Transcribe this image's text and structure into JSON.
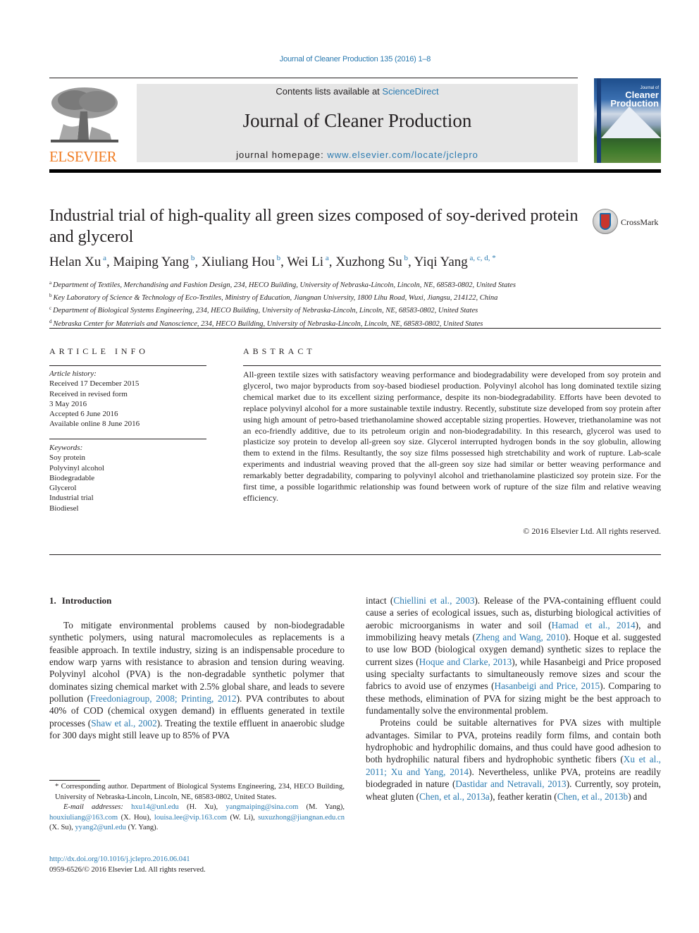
{
  "header": {
    "journal_ref": "Journal of Cleaner Production 135 (2016) 1–8",
    "contents_prefix": "Contents lists available at ",
    "contents_link": "ScienceDirect",
    "journal_title": "Journal of Cleaner Production",
    "homepage_prefix": "journal homepage: ",
    "homepage_link": "www.elsevier.com/locate/jclepro",
    "publisher_wordmark": "ELSEVIER",
    "cover_kicker": "Journal of",
    "cover_title_1": "Cleaner",
    "cover_title_2": "Production",
    "crossmark_label": "CrossMark"
  },
  "article": {
    "title": "Industrial trial of high-quality all green sizes composed of soy-derived protein and glycerol",
    "authors": [
      {
        "name": "Helan Xu",
        "sup": "a"
      },
      {
        "name": "Maiping Yang",
        "sup": "b"
      },
      {
        "name": "Xiuliang Hou",
        "sup": "b"
      },
      {
        "name": "Wei Li",
        "sup": "a"
      },
      {
        "name": "Xuzhong Su",
        "sup": "b"
      },
      {
        "name": "Yiqi Yang",
        "sup": "a, c, d, *"
      }
    ],
    "affiliations": [
      {
        "key": "a",
        "text": "Department of Textiles, Merchandising and Fashion Design, 234, HECO Building, University of Nebraska-Lincoln, Lincoln, NE, 68583-0802, United States"
      },
      {
        "key": "b",
        "text": "Key Laboratory of Science & Technology of Eco-Textiles, Ministry of Education, Jiangnan University, 1800 Lihu Road, Wuxi, Jiangsu, 214122, China"
      },
      {
        "key": "c",
        "text": "Department of Biological Systems Engineering, 234, HECO Building, University of Nebraska-Lincoln, Lincoln, NE, 68583-0802, United States"
      },
      {
        "key": "d",
        "text": "Nebraska Center for Materials and Nanoscience, 234, HECO Building, University of Nebraska-Lincoln, Lincoln, NE, 68583-0802, United States"
      }
    ]
  },
  "article_info": {
    "heading": "ARTICLE INFO",
    "history_label": "Article history:",
    "history": [
      "Received 17 December 2015",
      "Received in revised form",
      "3 May 2016",
      "Accepted 6 June 2016",
      "Available online 8 June 2016"
    ],
    "keywords_label": "Keywords:",
    "keywords": [
      "Soy protein",
      "Polyvinyl alcohol",
      "Biodegradable",
      "Glycerol",
      "Industrial trial",
      "Biodiesel"
    ]
  },
  "abstract": {
    "heading": "ABSTRACT",
    "text": "All-green textile sizes with satisfactory weaving performance and biodegradability were developed from soy protein and glycerol, two major byproducts from soy-based biodiesel production. Polyvinyl alcohol has long dominated textile sizing chemical market due to its excellent sizing performance, despite its non-biodegradability. Efforts have been devoted to replace polyvinyl alcohol for a more sustainable textile industry. Recently, substitute size developed from soy protein after using high amount of petro-based triethanolamine showed acceptable sizing properties. However, triethanolamine was not an eco-friendly additive, due to its petroleum origin and non-biodegradability. In this research, glycerol was used to plasticize soy protein to develop all-green soy size. Glycerol interrupted hydrogen bonds in the soy globulin, allowing them to extend in the films. Resultantly, the soy size films possessed high stretchability and work of rupture. Lab-scale experiments and industrial weaving proved that the all-green soy size had similar or better weaving performance and remarkably better degradability, comparing to polyvinyl alcohol and triethanolamine plasticized soy protein size. For the first time, a possible logarithmic relationship was found between work of rupture of the size film and relative weaving efficiency.",
    "copyright": "© 2016 Elsevier Ltd. All rights reserved."
  },
  "introduction": {
    "number": "1.",
    "heading": "Introduction",
    "left_column": [
      {
        "t": "To mitigate environmental problems caused by non-biodegradable synthetic polymers, using natural macromolecules as replacements is a feasible approach. In textile industry, sizing is an indispensable procedure to endow warp yarns with resistance to abrasion and tension during weaving. Polyvinyl alcohol (PVA) is the non-degradable synthetic polymer that dominates sizing chemical market with 2.5% global share, and leads to severe pollution ("
      },
      {
        "link": "Freedoniagroup, 2008; Printing, 2012"
      },
      {
        "t": "). PVA contributes to about 40% of COD (chemical oxygen demand) in effluents generated in textile processes ("
      },
      {
        "link": "Shaw et al., 2002"
      },
      {
        "t": "). Treating the textile effluent in anaerobic sludge for 300 days might still leave up to 85% of PVA"
      }
    ],
    "right_column_p1": [
      {
        "t": "intact ("
      },
      {
        "link": "Chiellini et al., 2003"
      },
      {
        "t": "). Release of the PVA-containing effluent could cause a series of ecological issues, such as, disturbing biological activities of aerobic microorganisms in water and soil ("
      },
      {
        "link": "Hamad et al., 2014"
      },
      {
        "t": "), and immobilizing heavy metals ("
      },
      {
        "link": "Zheng and Wang, 2010"
      },
      {
        "t": "). Hoque et al. suggested to use low BOD (biological oxygen demand) synthetic sizes to replace the current sizes ("
      },
      {
        "link": "Hoque and Clarke, 2013"
      },
      {
        "t": "), while Hasanbeigi and Price proposed using specialty surfactants to simultaneously remove sizes and scour the fabrics to avoid use of enzymes ("
      },
      {
        "link": "Hasanbeigi and Price, 2015"
      },
      {
        "t": "). Comparing to these methods, elimination of PVA for sizing might be the best approach to fundamentally solve the environmental problem."
      }
    ],
    "right_column_p2": [
      {
        "t": "Proteins could be suitable alternatives for PVA sizes with multiple advantages. Similar to PVA, proteins readily form films, and contain both hydrophobic and hydrophilic domains, and thus could have good adhesion to both hydrophilic natural fibers and hydrophobic synthetic fibers ("
      },
      {
        "link": "Xu et al., 2011; Xu and Yang, 2014"
      },
      {
        "t": "). Nevertheless, unlike PVA, proteins are readily biodegraded in nature ("
      },
      {
        "link": "Dastidar and Netravali, 2013"
      },
      {
        "t": "). Currently, soy protein, wheat gluten ("
      },
      {
        "link": "Chen, et al., 2013a"
      },
      {
        "t": "), feather keratin ("
      },
      {
        "link": "Chen, et al., 2013b"
      },
      {
        "t": ") and"
      }
    ]
  },
  "footnotes": {
    "corresponding": "* Corresponding author. Department of Biological Systems Engineering, 234, HECO Building, University of Nebraska-Lincoln, Lincoln, NE, 68583-0802, United States.",
    "email_label": "E-mail addresses:",
    "emails": [
      {
        "email": "hxu14@unl.edu",
        "who": " (H. Xu), "
      },
      {
        "email": "yangmaiping@sina.com",
        "who": " (M. Yang), "
      },
      {
        "email": "houxiuliang@163.com",
        "who": " (X. Hou), "
      },
      {
        "email": "louisa.lee@vip.163.com",
        "who": " (W. Li), "
      },
      {
        "email": "suxuzhong@jiangnan.edu.cn",
        "who": " (X. Su), "
      },
      {
        "email": "yyang2@unl.edu",
        "who": " (Y. Yang)."
      }
    ],
    "doi": "http://dx.doi.org/10.1016/j.jclepro.2016.06.041",
    "issn_copyright": "0959-6526/© 2016 Elsevier Ltd. All rights reserved."
  },
  "colors": {
    "link": "#2a7ab0",
    "elsevier_orange": "#f07e26",
    "masthead_bg": "#e6e6e6",
    "text": "#231f20"
  }
}
